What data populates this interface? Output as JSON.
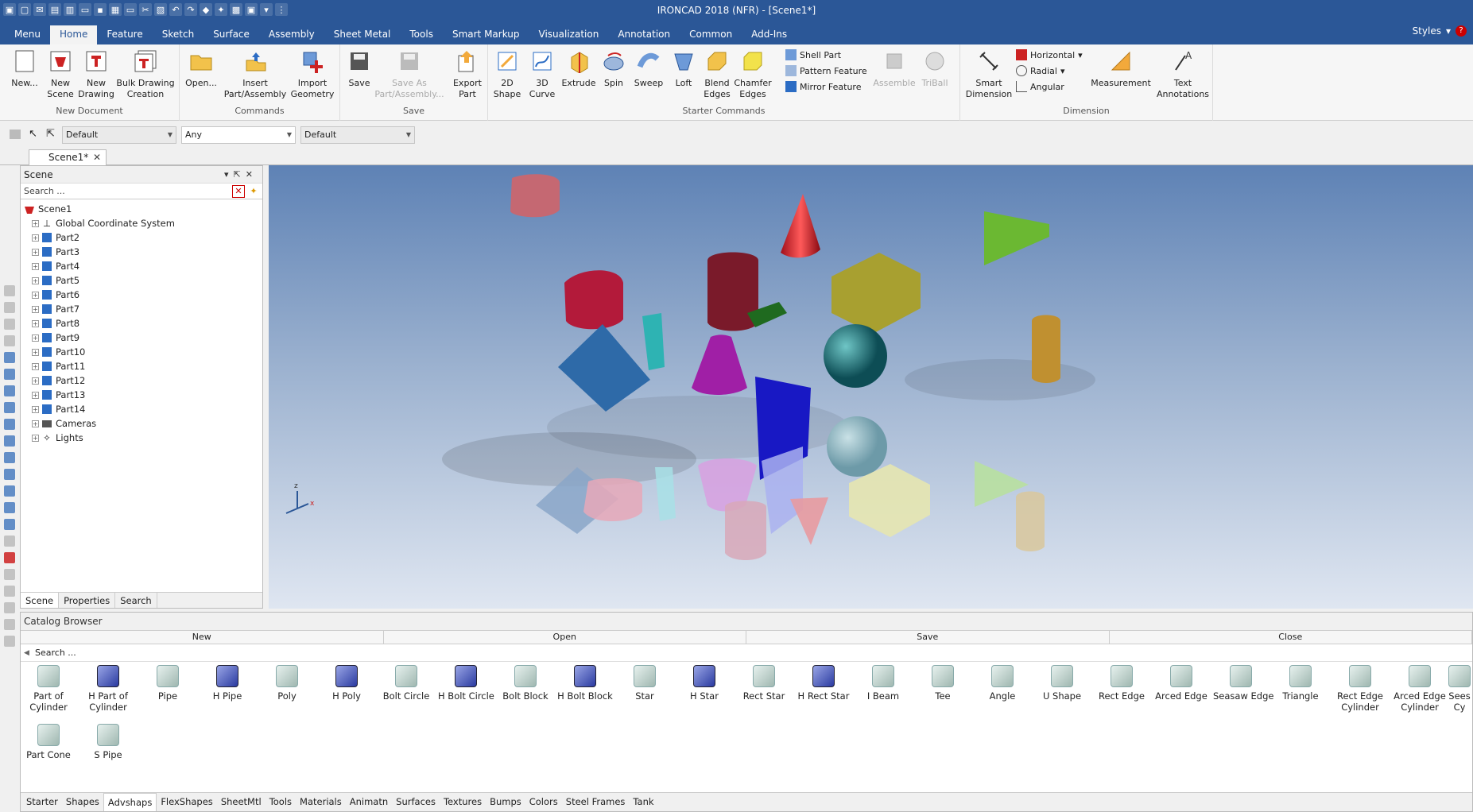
{
  "window": {
    "title": "IRONCAD 2018 (NFR) - [Scene1*]"
  },
  "ribbon_tabs": [
    "Menu",
    "Home",
    "Feature",
    "Sketch",
    "Surface",
    "Assembly",
    "Sheet Metal",
    "Tools",
    "Smart Markup",
    "Visualization",
    "Annotation",
    "Common",
    "Add-Ins"
  ],
  "styles_label": "Styles",
  "groups": {
    "new_document": "New Document",
    "commands": "Commands",
    "save": "Save",
    "starter": "Starter Commands",
    "dimension": "Dimension"
  },
  "buttons": {
    "new": "New...",
    "new_scene": "New\nScene",
    "new_drawing": "New\nDrawing",
    "bulk": "Bulk Drawing\nCreation",
    "open": "Open...",
    "insert": "Insert\nPart/Assembly",
    "import": "Import\nGeometry",
    "save": "Save",
    "save_as": "Save As\nPart/Assembly...",
    "export": "Export\nPart",
    "shape2d": "2D\nShape",
    "curve3d": "3D\nCurve",
    "extrude": "Extrude",
    "spin": "Spin",
    "sweep": "Sweep",
    "loft": "Loft",
    "blend": "Blend\nEdges",
    "chamfer": "Chamfer\nEdges",
    "shell": "Shell Part",
    "pattern": "Pattern Feature",
    "mirror": "Mirror Feature",
    "assemble": "Assemble",
    "triball": "TriBall",
    "smart_dim": "Smart\nDimension",
    "horizontal": "Horizontal",
    "radial": "Radial",
    "angular": "Angular",
    "measurement": "Measurement",
    "text_ann": "Text\nAnnotations"
  },
  "toolbar_combos": [
    "Default",
    "Any",
    "Default"
  ],
  "doc_tab": "Scene1*",
  "scene_panel": {
    "title": "Scene",
    "search_placeholder": "Search ...",
    "root": "Scene1",
    "items": [
      "Global Coordinate System",
      "Part2",
      "Part3",
      "Part4",
      "Part5",
      "Part6",
      "Part7",
      "Part8",
      "Part9",
      "Part10",
      "Part11",
      "Part12",
      "Part13",
      "Part14",
      "Cameras",
      "Lights"
    ],
    "tabs": [
      "Scene",
      "Properties",
      "Search"
    ]
  },
  "catalog": {
    "title": "Catalog Browser",
    "actions": [
      "New",
      "Open",
      "Save",
      "Close"
    ],
    "search_placeholder": "Search ...",
    "items": [
      "Part of\nCylinder",
      "H Part of\nCylinder",
      "Pipe",
      "H Pipe",
      "Poly",
      "H Poly",
      "Bolt Circle",
      "H Bolt Circle",
      "Bolt Block",
      "H Bolt Block",
      "Star",
      "H Star",
      "Rect Star",
      "H Rect Star",
      "I Beam",
      "Tee",
      "Angle",
      "U Shape",
      "Rect Edge",
      "Arced Edge",
      "Seasaw Edge",
      "Triangle",
      "Rect Edge\nCylinder",
      "Arced Edge\nCylinder",
      "Sees\nCy",
      "Part Cone",
      "S Pipe"
    ],
    "tabs": [
      "Starter",
      "Shapes",
      "Advshaps",
      "FlexShapes",
      "SheetMtl",
      "Tools",
      "Materials",
      "Animatn",
      "Surfaces",
      "Textures",
      "Bumps",
      "Colors",
      "Steel Frames",
      "Tank"
    ]
  },
  "colors": {
    "accent": "#2b5797"
  }
}
